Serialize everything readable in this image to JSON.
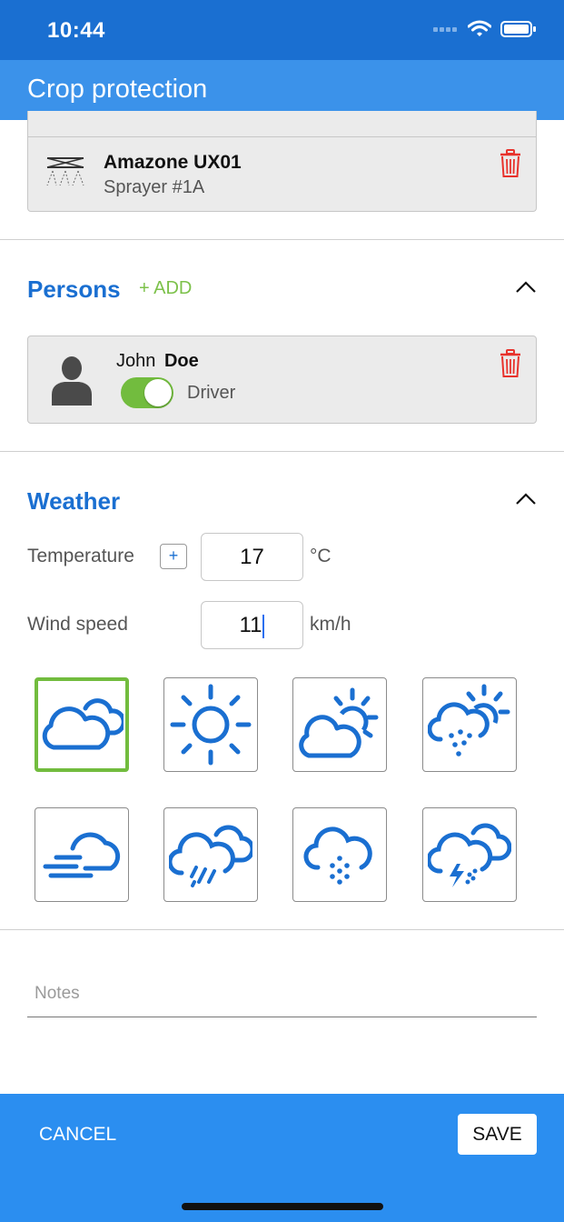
{
  "status": {
    "time": "10:44"
  },
  "app": {
    "title": "Crop protection"
  },
  "equipment": {
    "name": "Amazone UX01",
    "subtitle": "Sprayer #1A"
  },
  "persons": {
    "title": "Persons",
    "add_label": "+ ADD",
    "first_name": "John",
    "last_name": "Doe",
    "role_label": "Driver",
    "role_on": true
  },
  "weather": {
    "title": "Weather",
    "temperature_label": "Temperature",
    "temperature_plus": "+",
    "temperature_value": "17",
    "temperature_unit": "°C",
    "wind_label": "Wind speed",
    "wind_value": "11",
    "wind_unit": "km/h",
    "conditions": [
      "cloudy",
      "sunny",
      "partly-cloudy",
      "sun-showers",
      "fog",
      "rain",
      "snow",
      "thunderstorm"
    ],
    "selected": "cloudy"
  },
  "notes": {
    "placeholder": "Notes"
  },
  "footer": {
    "cancel_label": "CANCEL",
    "save_label": "SAVE"
  },
  "colors": {
    "primary": "#1a6fd1",
    "app_bar": "#3b92ea",
    "accent_green": "#72bc3e",
    "delete_red": "#e8322c",
    "footer": "#2b8ef0"
  }
}
